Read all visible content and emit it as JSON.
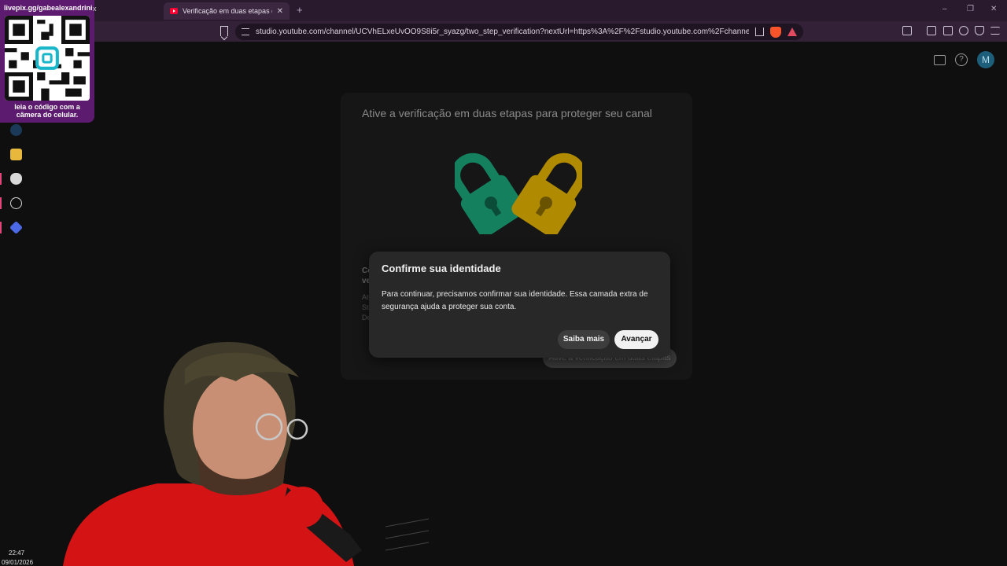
{
  "browser": {
    "tab_title": "Verificação em duas etapas do c",
    "tab_close": "✕",
    "new_tab": "+",
    "url": "studio.youtube.com/channel/UCVhELxeUvOO9S8i5r_syazg/two_step_verification?nextUrl=https%3A%2F%2Fstudio.youtube.com%2Fchannel%2FUCV...",
    "window_controls": [
      "–",
      "❐",
      "✕"
    ],
    "toolbar_icons": [
      "sidebar-icon",
      "wallet-icon",
      "leo-ai-icon",
      "vpn-shield-icon",
      "menu-icon"
    ]
  },
  "studio": {
    "avatar_letter": "M",
    "help_glyph": "?",
    "card_title": "Ative a verificação em duas etapas para proteger seu canal",
    "card_body_fragments": {
      "heading_1": "Co",
      "heading_2": "ve",
      "lines": [
        "At",
        "St",
        "De"
      ]
    },
    "enable_button": "Ative a verificação em duas etapas",
    "lock_colors": {
      "green": "#14805e",
      "gold": "#b08a00"
    }
  },
  "dialog": {
    "title": "Confirme sua identidade",
    "body": "Para continuar, precisamos confirmar sua identidade. Essa camada extra de segurança ajuda a proteger sua conta.",
    "learn_more": "Saiba mais",
    "next": "Avançar"
  },
  "overlay": {
    "handle": "livepix.gg/gabealexandrini",
    "close": "x",
    "caption": "leia o código com a câmera do celular."
  },
  "taskbar": {
    "icons": [
      "steam-icon",
      "file-explorer-icon",
      "shield-app-icon",
      "speedtest-icon",
      "diamond-app-icon"
    ]
  },
  "clock": {
    "time": "22:47",
    "date": "09/01/2026"
  }
}
